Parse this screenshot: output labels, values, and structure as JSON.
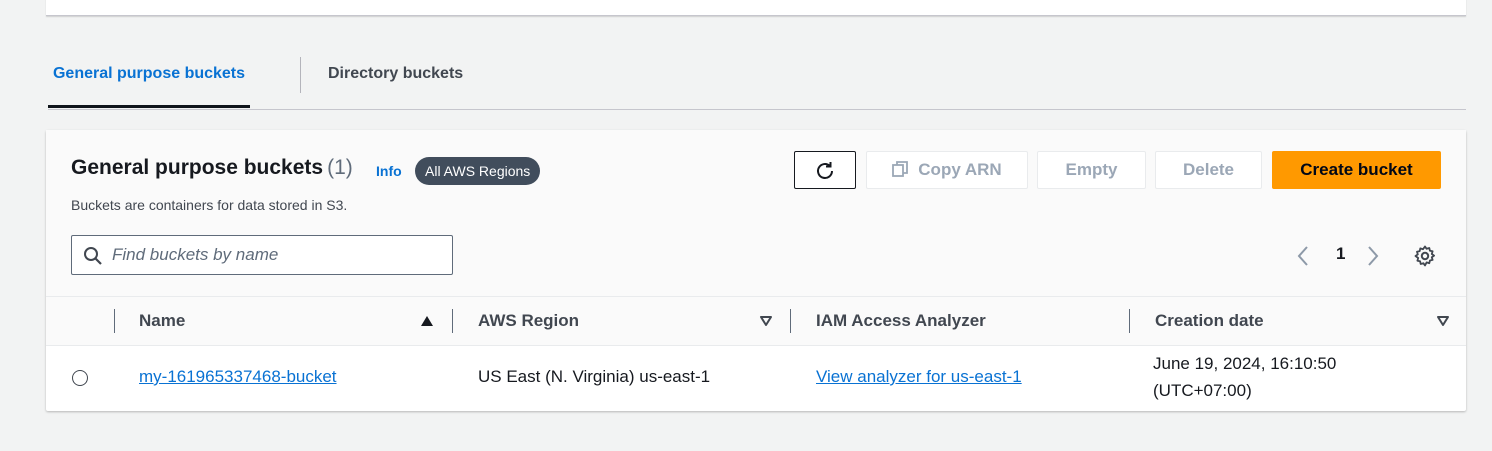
{
  "tabs": [
    {
      "label": "General purpose buckets",
      "active": true
    },
    {
      "label": "Directory buckets",
      "active": false
    }
  ],
  "panel": {
    "title": "General purpose buckets",
    "count": "(1)",
    "info_label": "Info",
    "region_badge": "All AWS Regions",
    "description": "Buckets are containers for data stored in S3."
  },
  "toolbar": {
    "refresh_icon": "refresh-icon",
    "copy_arn_label": "Copy ARN",
    "empty_label": "Empty",
    "delete_label": "Delete",
    "create_label": "Create bucket"
  },
  "search": {
    "placeholder": "Find buckets by name",
    "value": ""
  },
  "pagination": {
    "current_page": "1"
  },
  "table": {
    "columns": [
      "Name",
      "AWS Region",
      "IAM Access Analyzer",
      "Creation date"
    ],
    "rows": [
      {
        "name": "my-161965337468-bucket",
        "region": "US East (N. Virginia) us-east-1",
        "analyzer": "View analyzer for us-east-1",
        "created_line1": "June 19, 2024, 16:10:50",
        "created_line2": "(UTC+07:00)"
      }
    ]
  },
  "colors": {
    "accent": "#0972d3",
    "primary_button": "#ff9900",
    "badge": "#414d5c",
    "page_background": "#f2f3f3"
  }
}
